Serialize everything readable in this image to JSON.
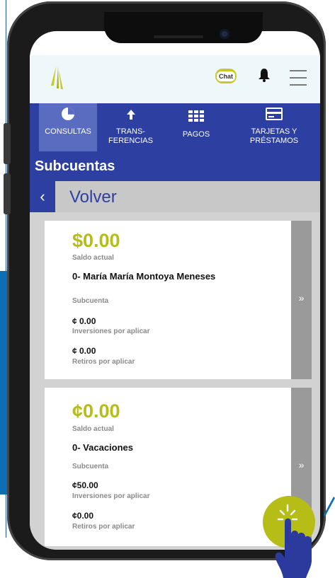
{
  "colors": {
    "brand_blue": "#2d3fa0",
    "accent_lime": "#b5bd16",
    "nav_active": "#5a6cc0",
    "card_stripe": "#9a9a9a"
  },
  "header": {
    "chat_label": "Chat",
    "logo_icon": "logo-icon",
    "bell_icon": "bell-icon",
    "menu_icon": "menu-icon"
  },
  "nav": {
    "items": [
      {
        "label_line1": "CONSULTAS",
        "label_line2": "",
        "icon": "pie-chart-icon",
        "active": true
      },
      {
        "label_line1": "TRANS-",
        "label_line2": "FERENCIAS",
        "icon": "arrow-up-icon",
        "active": false
      },
      {
        "label_line1": "PAGOS",
        "label_line2": "",
        "icon": "grid-icon",
        "active": false
      },
      {
        "label_line1": "TARJETAS Y",
        "label_line2": "PRÉSTAMOS",
        "icon": "card-icon",
        "active": false
      }
    ]
  },
  "section": {
    "title": "Subcuentas"
  },
  "back": {
    "label": "Volver",
    "icon": "chevron-left-icon"
  },
  "accounts": [
    {
      "balance": "$0.00",
      "balance_label": "Saldo actual",
      "name": "0- María María Montoya Meneses",
      "type": "Subcuenta",
      "investments": "¢ 0.00",
      "investments_label": "Inversiones por aplicar",
      "withdrawals": "¢ 0.00",
      "withdrawals_label": "Retiros por aplicar",
      "arrow": "»"
    },
    {
      "balance": "¢0.00",
      "balance_label": "Saldo actual",
      "name": "0- Vacaciones",
      "type": "Subcuenta",
      "investments": "¢50.00",
      "investments_label": "Inversiones por aplicar",
      "withdrawals": "¢0.00",
      "withdrawals_label": "Retiros por aplicar",
      "arrow": "»"
    }
  ]
}
